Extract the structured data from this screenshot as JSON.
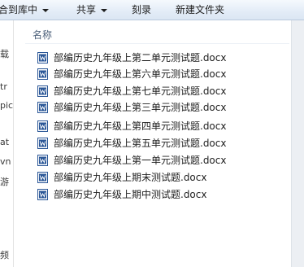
{
  "toolbar": {
    "include_library": "合到库中",
    "share": "共享",
    "burn": "刻录",
    "new_folder": "新建文件夹"
  },
  "nav_fragments": [
    "载",
    "tr",
    "pic",
    "at",
    "vn",
    "游",
    "频"
  ],
  "list": {
    "column_name": "名称",
    "files": [
      "部编历史九年级上第二单元测试题.docx",
      "部编历史九年级上第六单元测试题.docx",
      "部编历史九年级上第七单元测试题.docx",
      "部编历史九年级上第三单元测试题.docx",
      "部编历史九年级上第四单元测试题.docx",
      "部编历史九年级上第五单元测试题.docx",
      "部编历史九年级上第一单元测试题.docx",
      "部编历史九年级上期末测试题.docx",
      "部编历史九年级上期中测试题.docx"
    ]
  },
  "colors": {
    "toolbar_bg": "#e3ecf7",
    "word_blue": "#2b5797",
    "header_text": "#4c607a"
  },
  "icons": {
    "file": "word-document-icon",
    "dropdown": "chevron-down-icon"
  }
}
